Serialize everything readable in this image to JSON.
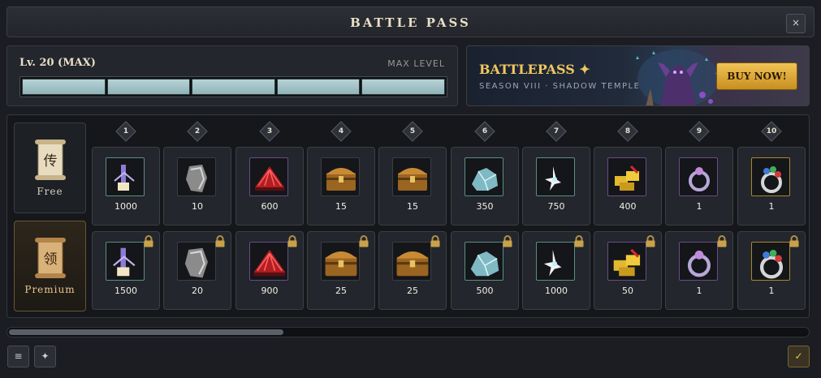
{
  "header": {
    "title": "BATTLE PASS",
    "close_icon": "×"
  },
  "level": {
    "label": "Lv. 20 (MAX)",
    "status": "MAX LEVEL",
    "progress_fraction": 1.0,
    "segments": 5
  },
  "banner": {
    "title": "BATTLEPASS ✦",
    "subtitle": "SEASON VIII · SHADOW TEMPLE",
    "buy_label": "BUY NOW!"
  },
  "tracks": {
    "free_label": "Free",
    "premium_label": "Premium",
    "free_glyph": "传",
    "premium_glyph": "领"
  },
  "levels": [
    {
      "num": "1",
      "free_qty": "1000",
      "premium_qty": "1500",
      "icon": "shard-icon",
      "frame": "#5a8e85"
    },
    {
      "num": "2",
      "free_qty": "10",
      "premium_qty": "20",
      "icon": "ore-icon",
      "frame": "#3a3d44"
    },
    {
      "num": "3",
      "free_qty": "600",
      "premium_qty": "900",
      "icon": "red-fan-icon",
      "frame": "#6a4b8a"
    },
    {
      "num": "4",
      "free_qty": "15",
      "premium_qty": "25",
      "icon": "chest-icon",
      "frame": "#3a3d44"
    },
    {
      "num": "5",
      "free_qty": "15",
      "premium_qty": "25",
      "icon": "chest-icon",
      "frame": "#3a3d44"
    },
    {
      "num": "6",
      "free_qty": "350",
      "premium_qty": "500",
      "icon": "crystal-icon",
      "frame": "#5a8e85"
    },
    {
      "num": "7",
      "free_qty": "750",
      "premium_qty": "1000",
      "icon": "spark-icon",
      "frame": "#5a8e85"
    },
    {
      "num": "8",
      "free_qty": "400",
      "premium_qty": "50",
      "icon": "gold-icon",
      "frame": "#6a4b8a"
    },
    {
      "num": "9",
      "free_qty": "1",
      "premium_qty": "1",
      "icon": "ring-icon",
      "frame": "#6a4b8a"
    },
    {
      "num": "10",
      "free_qty": "1",
      "premium_qty": "1",
      "icon": "gem-ring-icon",
      "frame": "#a8872f"
    }
  ],
  "footer": {
    "menu_icon": "≡",
    "star_icon": "✦",
    "confirm_icon": "✓"
  }
}
